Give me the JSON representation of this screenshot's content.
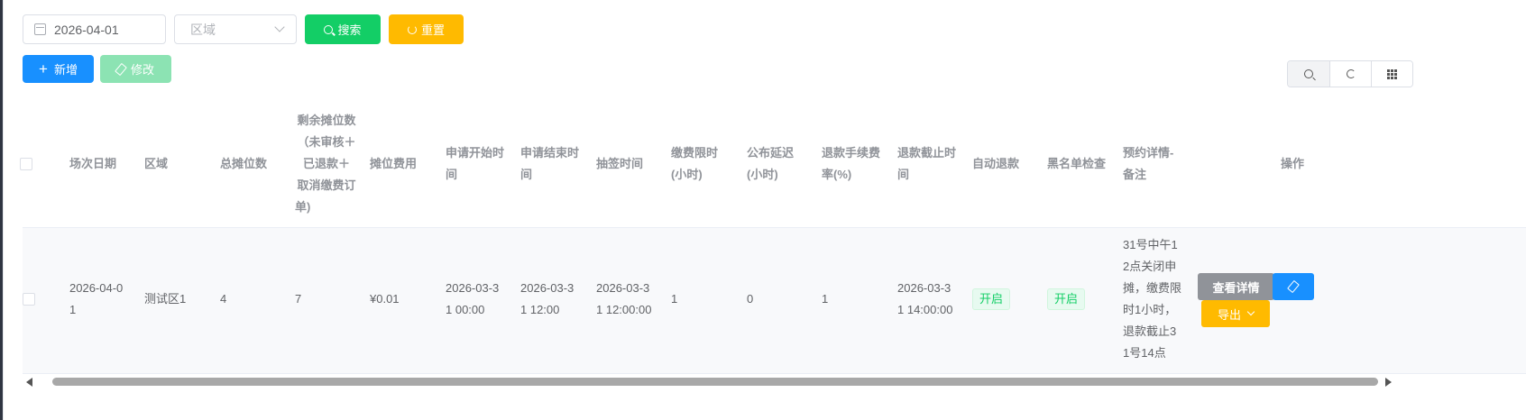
{
  "search": {
    "date_value": "2026-04-01",
    "region_placeholder": "区域",
    "search_label": "搜索",
    "reset_label": "重置"
  },
  "toolbar": {
    "add_label": "新增",
    "edit_label": "修改",
    "tool_icons": [
      "search-icon",
      "refresh-icon",
      "columns-icon"
    ]
  },
  "table": {
    "columns": {
      "date": [
        "场次日期"
      ],
      "region": [
        "区域"
      ],
      "total": [
        "总摊位数"
      ],
      "remaining": [
        "剩余摊位数",
        "（未审核＋",
        "已退款＋",
        "取消缴费订",
        "单)"
      ],
      "fee": [
        "摊位费用"
      ],
      "apply_start": [
        "申请开始时",
        "间"
      ],
      "apply_end": [
        "申请结束时",
        "间"
      ],
      "draw_time": [
        "抽签时间"
      ],
      "pay_limit": [
        "缴费限时",
        "(小时)"
      ],
      "publish_delay": [
        "公布延迟",
        "(小时)"
      ],
      "refund_fee_rate": [
        "退款手续费",
        "率(%)"
      ],
      "refund_deadline": [
        "退款截止时",
        "间"
      ],
      "auto_refund": [
        "自动退款"
      ],
      "blacklist_check": [
        "黑名单检查"
      ],
      "booking_note": [
        "预约详情-",
        "备注"
      ],
      "actions": [
        "操作"
      ]
    },
    "rows": [
      {
        "date": [
          "2026-04-0",
          "1"
        ],
        "region": [
          "测试区1"
        ],
        "total": [
          "4"
        ],
        "remaining": [
          "7"
        ],
        "fee": [
          "¥0.01"
        ],
        "apply_start": [
          "2026-03-3",
          "1 00:00"
        ],
        "apply_end": [
          "2026-03-3",
          "1 12:00"
        ],
        "draw_time": [
          "2026-03-3",
          "1 12:00:00"
        ],
        "pay_limit": [
          "1"
        ],
        "publish_delay": [
          "0"
        ],
        "refund_fee_rate": [
          "1"
        ],
        "refund_deadline": [
          "2026-03-3",
          "1 14:00:00"
        ],
        "auto_refund": "开启",
        "blacklist_check": "开启",
        "booking_note": [
          "31号中午1",
          "2点关闭申",
          "摊，缴费限",
          "时1小时，",
          "退款截止3",
          "1号14点"
        ],
        "detail_label": "查看详情",
        "export_label": "导出"
      }
    ]
  },
  "colors": {
    "primary": "#1890ff",
    "success": "#13ce66",
    "warning": "#ffba00",
    "info": "#909399"
  }
}
